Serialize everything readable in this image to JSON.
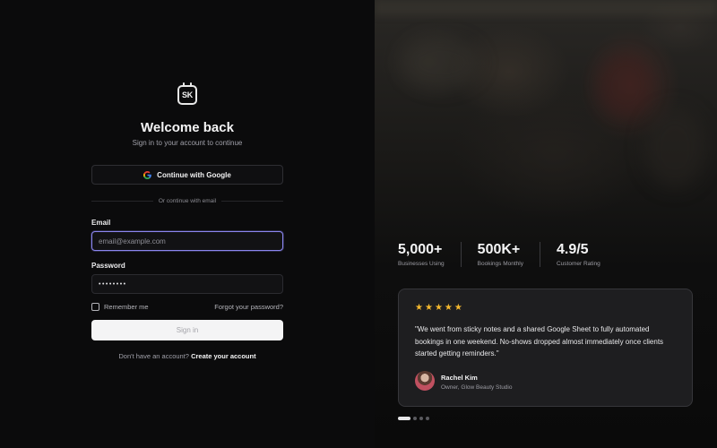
{
  "login": {
    "logo_text": "SK",
    "title": "Welcome back",
    "subtitle": "Sign in to your account to continue",
    "google_button": "Continue with Google",
    "divider_text": "Or continue with email",
    "email_label": "Email",
    "email_placeholder": "email@example.com",
    "password_label": "Password",
    "password_value": "••••••••",
    "remember_label": "Remember me",
    "forgot_link": "Forgot your password?",
    "signin_button": "Sign in",
    "no_account_text": "Don't have an account?",
    "create_account_link": "Create your account"
  },
  "stats": [
    {
      "value": "5,000+",
      "label": "Businesses Using"
    },
    {
      "value": "500K+",
      "label": "Bookings Monthly"
    },
    {
      "value": "4.9/5",
      "label": "Customer Rating"
    }
  ],
  "testimonial": {
    "rating": 5,
    "quote": "\"We went from sticky notes and a shared Google Sheet to fully automated bookings in one weekend. No-shows dropped almost immediately once clients started getting reminders.\"",
    "author": "Rachel Kim",
    "role": "Owner, Glow Beauty Studio"
  },
  "carousel": {
    "count": 4,
    "active_index": 0
  },
  "colors": {
    "accent_focus": "#8b86f0",
    "star": "#f5b82e",
    "background": "#0b0b0c"
  },
  "icons": {
    "logo": "calendar-icon",
    "google": "google-icon",
    "star": "star-icon"
  }
}
